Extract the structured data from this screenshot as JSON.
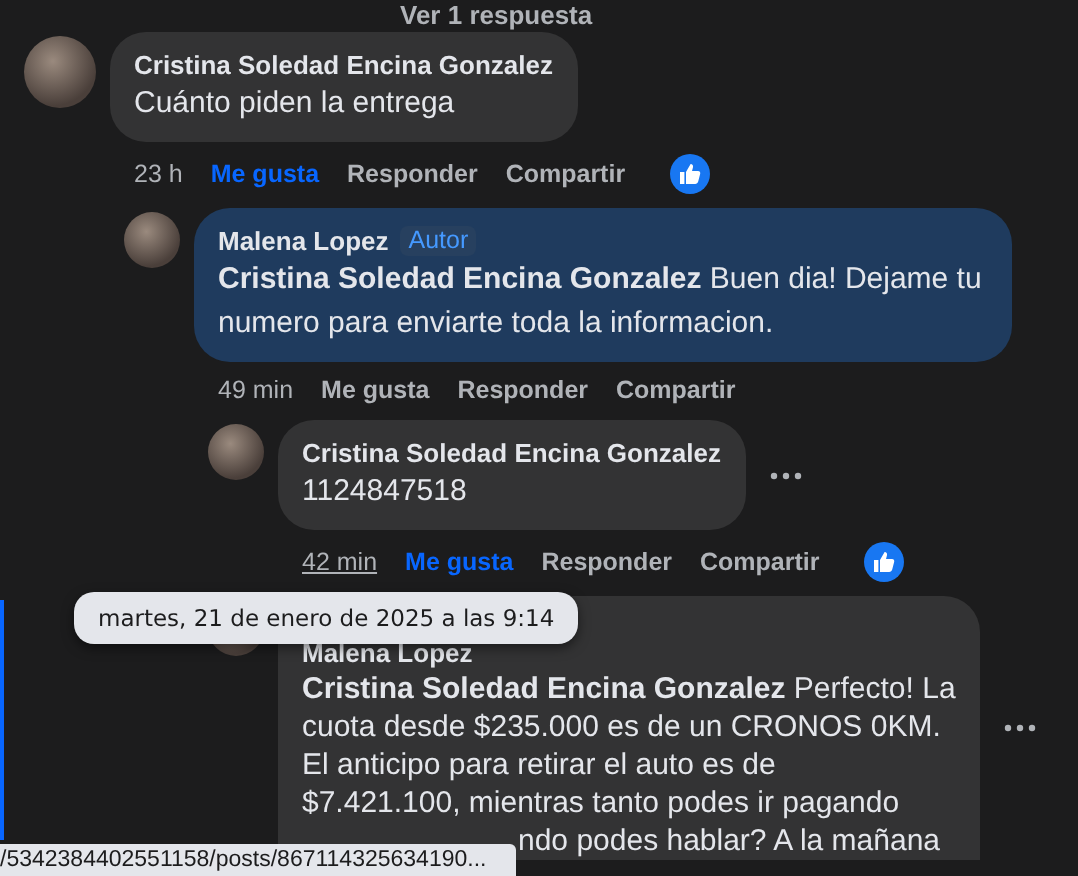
{
  "replies_link": "Ver 1 respuesta",
  "comments": [
    {
      "author": "Cristina Soledad Encina Gonzalez",
      "highlighted": false,
      "text": "Cuánto piden la entrega",
      "time": "23 h",
      "time_hover": false,
      "like_label": "Me gusta",
      "liked": true,
      "reply_label": "Responder",
      "share_label": "Compartir",
      "like_reaction": true,
      "more_button": false,
      "children": [
        {
          "author": "Malena Lopez",
          "badge": "Autor",
          "highlighted": true,
          "text": "**Cristina Soledad Encina Gonzalez** Buen dia! Dejame tu numero para enviarte toda la informacion.",
          "time": "49 min",
          "time_hover": false,
          "like_label": "Me gusta",
          "liked": false,
          "reply_label": "Responder",
          "share_label": "Compartir",
          "like_reaction": false,
          "more_button": false,
          "children": [
            {
              "author": "Cristina Soledad Encina Gonzalez",
              "highlighted": false,
              "text": "1124847518",
              "time": "42 min",
              "time_hover": true,
              "like_label": "Me gusta",
              "liked": true,
              "reply_label": "Responder",
              "share_label": "Compartir",
              "like_reaction": true,
              "more_button": true
            },
            {
              "author": "Malena Lopez",
              "highlighted": false,
              "text_lines": [
                "**Cristina Soledad Encina Gonzalez** Perfecto! La",
                "cuota desde $235.000 es de un CRONOS 0KM.",
                "El anticipo para retirar el auto es de",
                "$7.421.100, mientras tanto podes ir pagando"
              ],
              "text_tail": "ndo podes hablar? A la mañana",
              "more_button": true
            }
          ]
        }
      ]
    }
  ],
  "tooltip": "martes, 21 de enero de 2025 a las 9:14",
  "status_url": "/5342384402551158/posts/867114325634190..."
}
